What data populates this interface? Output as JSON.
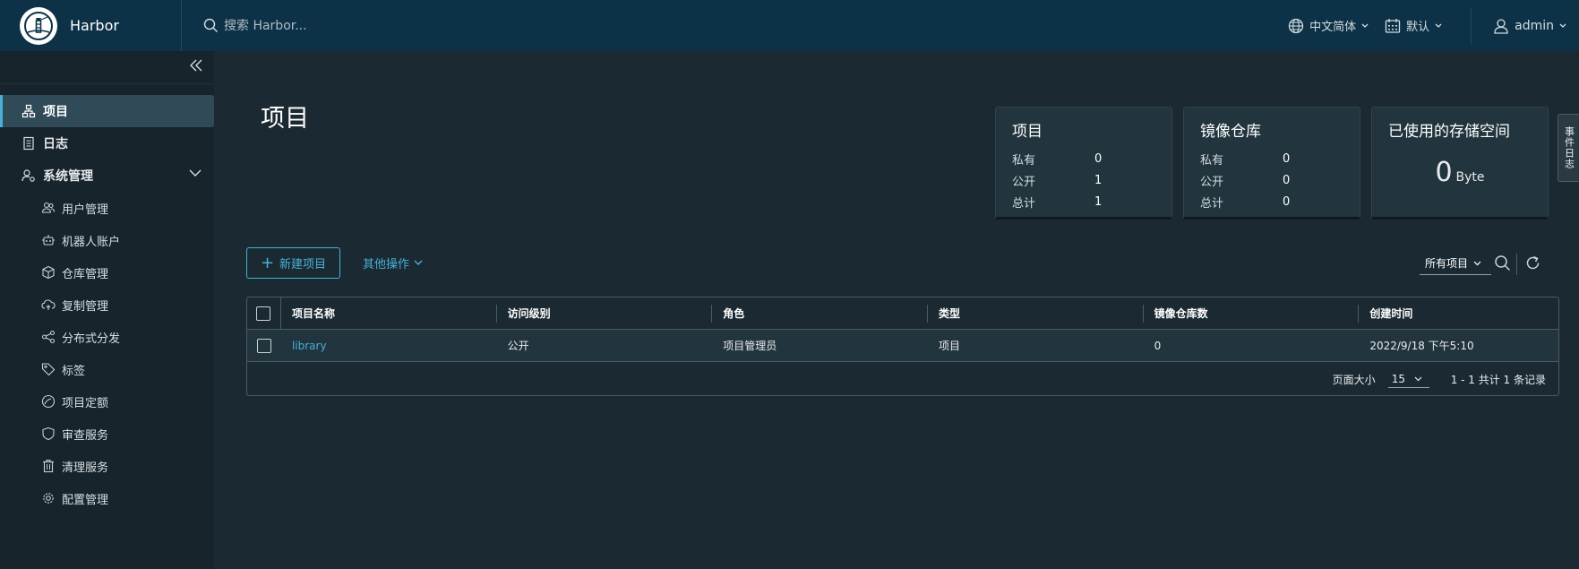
{
  "header": {
    "brand_title": "Harbor",
    "search_placeholder": "搜索 Harbor...",
    "language": "中文简体",
    "datetime_format": "默认",
    "user": "admin"
  },
  "sidebar": {
    "items": [
      {
        "label": "项目",
        "icon": "projects-icon",
        "active": true
      },
      {
        "label": "日志",
        "icon": "logs-icon"
      },
      {
        "label": "系统管理",
        "icon": "admin-icon"
      }
    ],
    "sub_items": [
      {
        "label": "用户管理",
        "icon": "users-icon"
      },
      {
        "label": "机器人账户",
        "icon": "robot-icon"
      },
      {
        "label": "仓库管理",
        "icon": "registry-icon"
      },
      {
        "label": "复制管理",
        "icon": "replication-icon"
      },
      {
        "label": "分布式分发",
        "icon": "distribution-icon"
      },
      {
        "label": "标签",
        "icon": "tag-icon"
      },
      {
        "label": "项目定额",
        "icon": "quota-icon"
      },
      {
        "label": "审查服务",
        "icon": "shield-icon"
      },
      {
        "label": "清理服务",
        "icon": "trash-icon"
      },
      {
        "label": "配置管理",
        "icon": "gear-icon"
      }
    ]
  },
  "main": {
    "title": "项目",
    "cards": {
      "projects": {
        "title": "项目",
        "rows": [
          {
            "k": "私有",
            "v": "0"
          },
          {
            "k": "公开",
            "v": "1"
          },
          {
            "k": "总计",
            "v": "1"
          }
        ]
      },
      "repos": {
        "title": "镜像仓库",
        "rows": [
          {
            "k": "私有",
            "v": "0"
          },
          {
            "k": "公开",
            "v": "0"
          },
          {
            "k": "总计",
            "v": "0"
          }
        ]
      },
      "storage": {
        "title": "已使用的存储空间",
        "value": "0",
        "unit": "Byte"
      }
    },
    "new_project_label": "新建项目",
    "other_actions_label": "其他操作",
    "filter_label": "所有项目",
    "table": {
      "headers": [
        "项目名称",
        "访问级别",
        "角色",
        "类型",
        "镜像仓库数",
        "创建时间"
      ],
      "rows": [
        {
          "name": "library",
          "access": "公开",
          "role": "项目管理员",
          "type": "项目",
          "repo_count": "0",
          "created": "2022/9/18 下午5:10"
        }
      ],
      "page_size_label": "页面大小",
      "page_size": "15",
      "pagination": "1 - 1 共计 1 条记录"
    },
    "side_tab_label": "事件日志"
  },
  "colors": {
    "accent": "#49afd9",
    "header_bg": "#0d3247",
    "sidebar_bg": "#17242b",
    "main_bg": "#1b2a32"
  }
}
